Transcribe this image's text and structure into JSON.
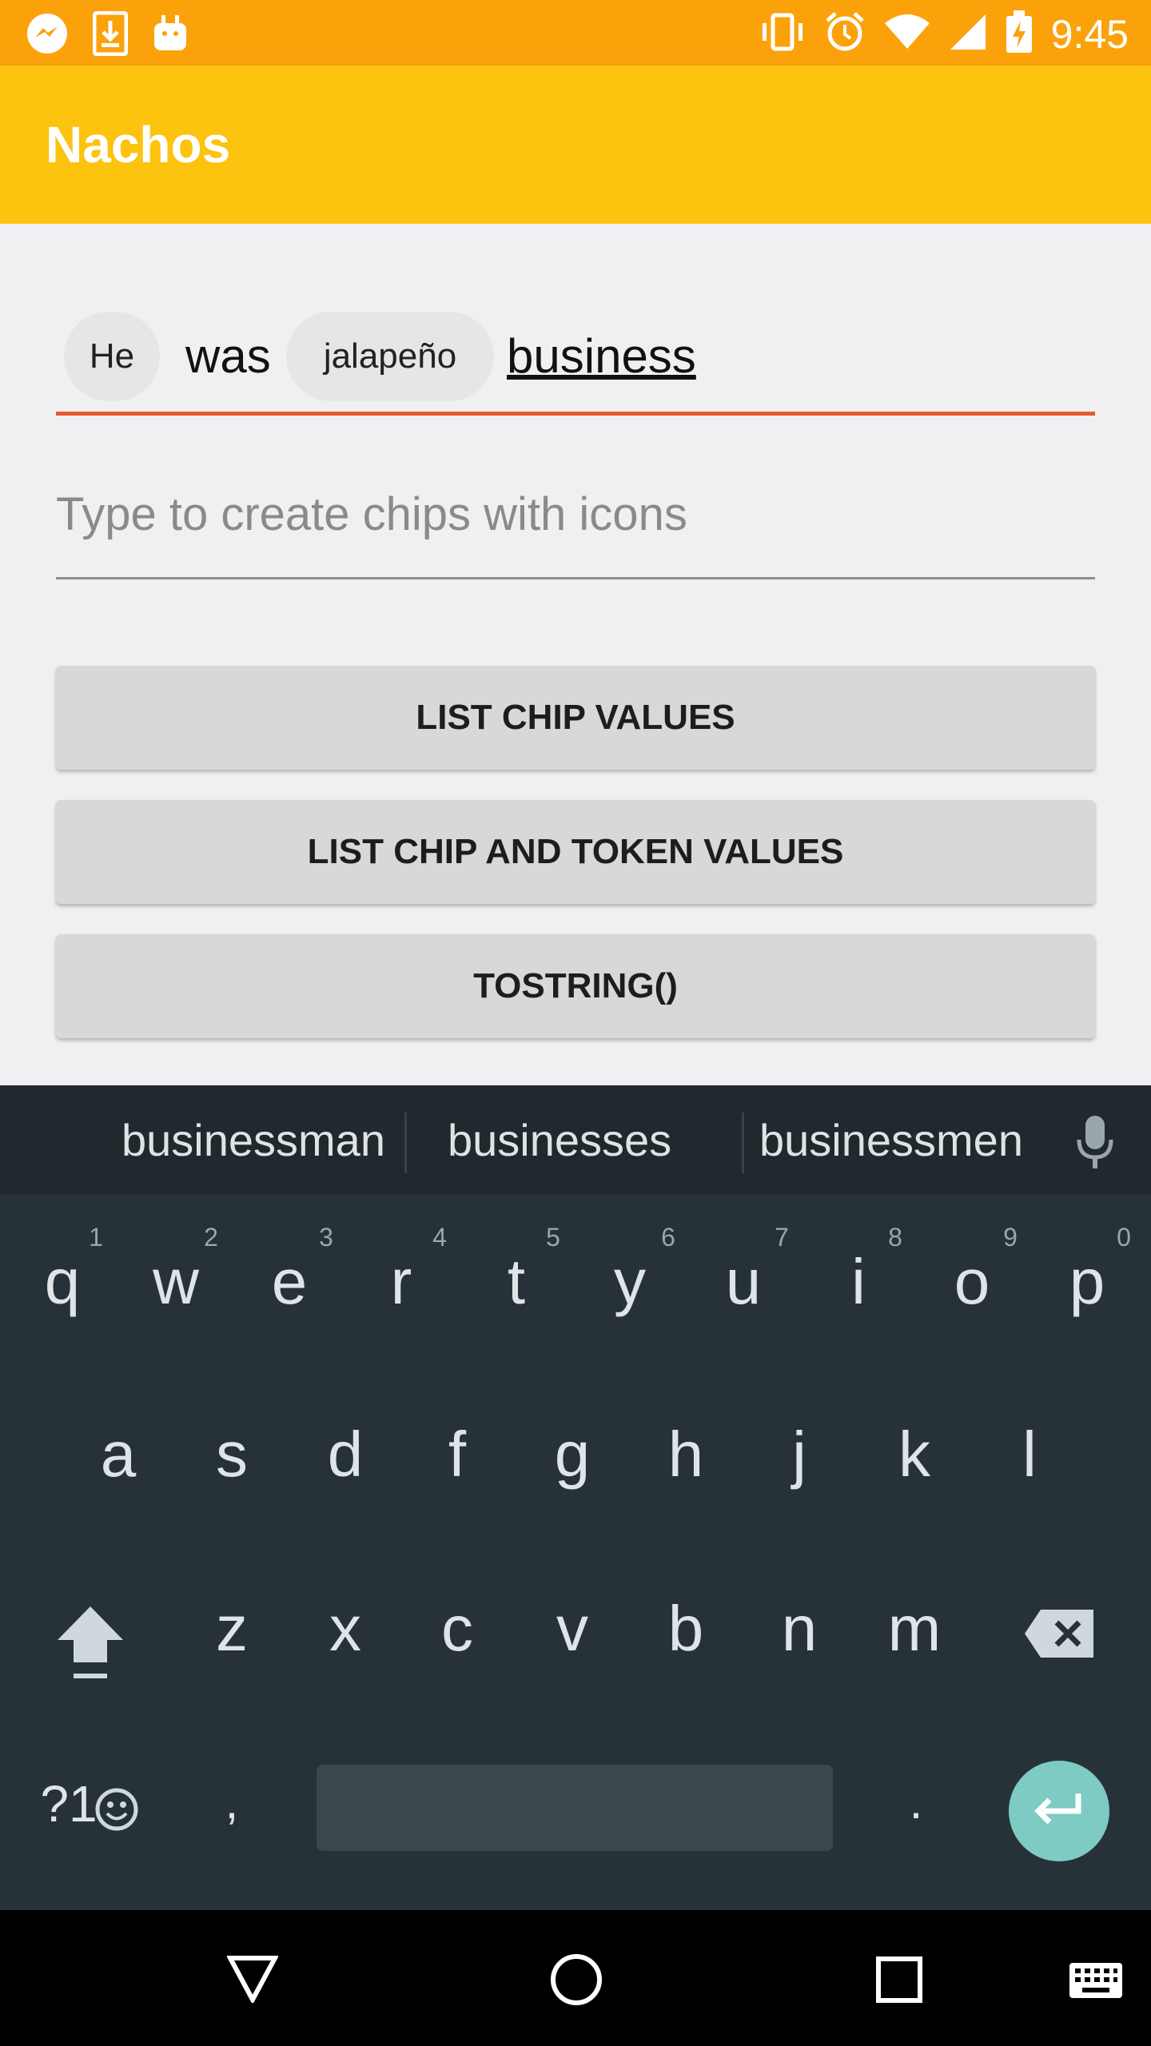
{
  "status_bar": {
    "time": "9:45",
    "left_icons": [
      "messenger-icon",
      "download-icon",
      "android-icon"
    ],
    "right_icons": [
      "vibrate-icon",
      "alarm-icon",
      "wifi-icon",
      "signal-icon",
      "battery-icon"
    ]
  },
  "app_bar": {
    "title": "Nachos"
  },
  "chip_field": {
    "items": [
      {
        "type": "chip",
        "text": "He"
      },
      {
        "type": "token",
        "text": "was"
      },
      {
        "type": "chip",
        "text": "jalapeño"
      },
      {
        "type": "token-current",
        "text": "business"
      }
    ]
  },
  "icon_field": {
    "placeholder": "Type to create chips with icons"
  },
  "buttons": [
    {
      "label": "LIST CHIP VALUES"
    },
    {
      "label": "LIST CHIP AND TOKEN VALUES"
    },
    {
      "label": "TOSTRING()"
    }
  ],
  "keyboard": {
    "suggestions": [
      "businessman",
      "businesses",
      "businessmen"
    ],
    "row1": [
      {
        "key": "q",
        "hint": "1"
      },
      {
        "key": "w",
        "hint": "2"
      },
      {
        "key": "e",
        "hint": "3"
      },
      {
        "key": "r",
        "hint": "4"
      },
      {
        "key": "t",
        "hint": "5"
      },
      {
        "key": "y",
        "hint": "6"
      },
      {
        "key": "u",
        "hint": "7"
      },
      {
        "key": "i",
        "hint": "8"
      },
      {
        "key": "o",
        "hint": "9"
      },
      {
        "key": "p",
        "hint": "0"
      }
    ],
    "row2": [
      "a",
      "s",
      "d",
      "f",
      "g",
      "h",
      "j",
      "k",
      "l"
    ],
    "row3": [
      "z",
      "x",
      "c",
      "v",
      "b",
      "n",
      "m"
    ],
    "symbols_label": "?1",
    "comma": ",",
    "period": "."
  },
  "colors": {
    "status_bar": "#fba20b",
    "app_bar": "#fcc30f",
    "accent_underline": "#e65a2e",
    "keyboard_bg": "#263238",
    "enter_key": "#7dcbc2"
  }
}
